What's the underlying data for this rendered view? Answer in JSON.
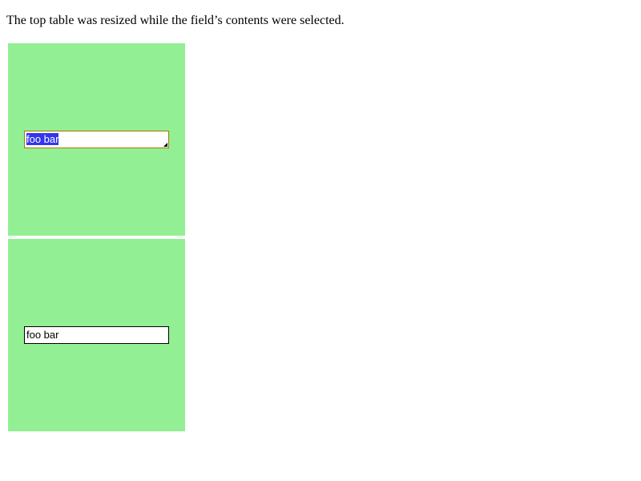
{
  "caption": "The top table was resized while the field’s contents were selected.",
  "top_field": {
    "value": "foo bar",
    "selected": true
  },
  "bottom_field": {
    "value": "foo bar",
    "selected": false
  },
  "colors": {
    "panel_background": "#93ef93",
    "selection_highlight": "#3535ee",
    "focused_field_border": "#b07300"
  }
}
